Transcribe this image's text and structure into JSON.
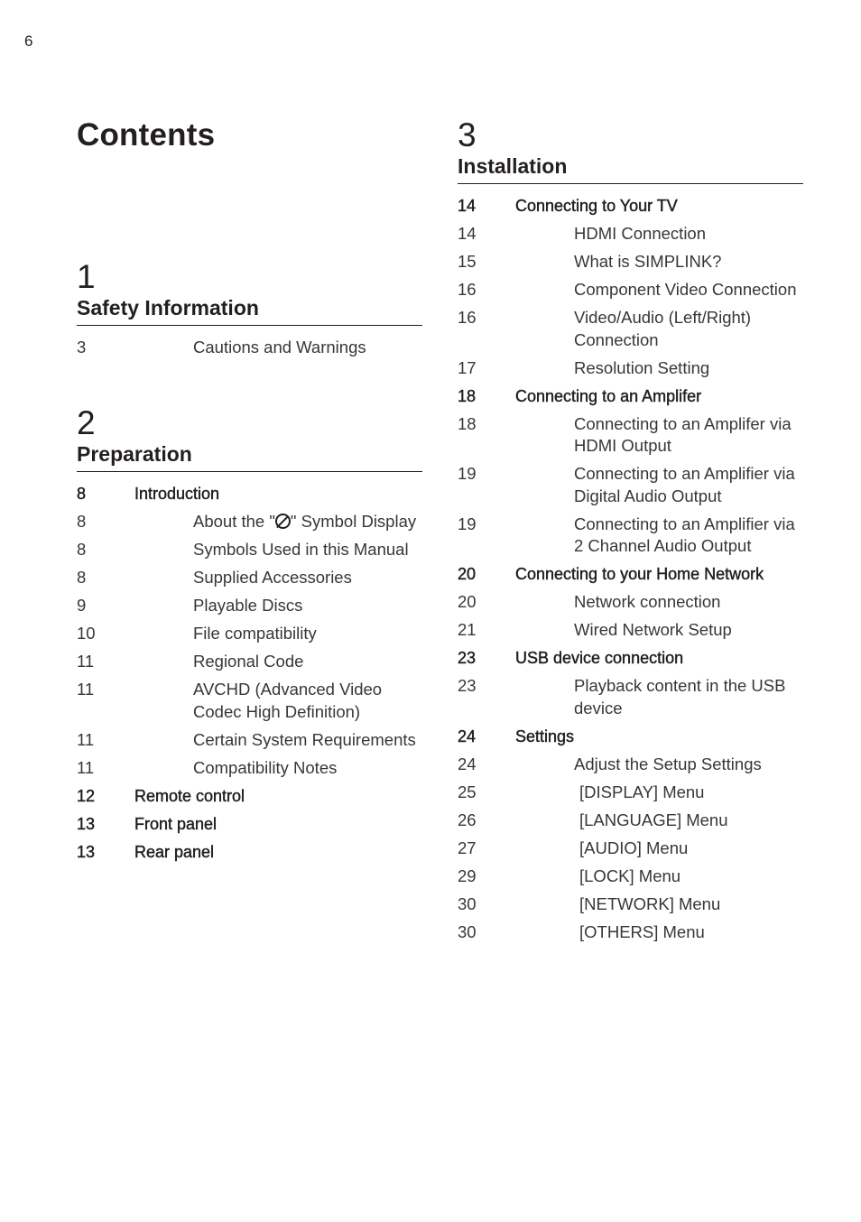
{
  "page_number": "6",
  "title": "Contents",
  "chapters": [
    {
      "number": "1",
      "title": "Safety Information",
      "entries": [
        {
          "page": "3",
          "level": 2,
          "text": "Cautions and Warnings"
        }
      ]
    },
    {
      "number": "2",
      "title": "Preparation",
      "entries": [
        {
          "page": "8",
          "level": 1,
          "text": "Introduction"
        },
        {
          "page": "8",
          "level": 2,
          "text_before": "About the \"",
          "icon": "prohibited-symbol-icon",
          "text_after": "\" Symbol Display"
        },
        {
          "page": "8",
          "level": 2,
          "text": "Symbols Used in this Manual"
        },
        {
          "page": "8",
          "level": 2,
          "text": "Supplied Accessories"
        },
        {
          "page": "9",
          "level": 2,
          "text": "Playable Discs"
        },
        {
          "page": "10",
          "level": 2,
          "text": "File compatibility"
        },
        {
          "page": "11",
          "level": 2,
          "text": "Regional Code"
        },
        {
          "page": "11",
          "level": 2,
          "text": "AVCHD (Advanced Video Codec High Definition)"
        },
        {
          "page": "11",
          "level": 2,
          "text": "Certain System Requirements"
        },
        {
          "page": "11",
          "level": 2,
          "text": "Compatibility Notes"
        },
        {
          "page": "12",
          "level": 1,
          "text": "Remote control"
        },
        {
          "page": "13",
          "level": 1,
          "text": "Front panel"
        },
        {
          "page": "13",
          "level": 1,
          "text": "Rear panel"
        }
      ]
    },
    {
      "number": "3",
      "title": "Installation",
      "entries": [
        {
          "page": "14",
          "level": 1,
          "text": "Connecting to Your TV"
        },
        {
          "page": "14",
          "level": 2,
          "text": "HDMI Connection"
        },
        {
          "page": "15",
          "level": 2,
          "text": "What is SIMPLINK?"
        },
        {
          "page": "16",
          "level": 2,
          "text": "Component Video Connection"
        },
        {
          "page": "16",
          "level": 2,
          "text": "Video/Audio (Left/Right) Connection"
        },
        {
          "page": "17",
          "level": 2,
          "text": "Resolution Setting"
        },
        {
          "page": "18",
          "level": 1,
          "text": "Connecting to an Amplifer"
        },
        {
          "page": "18",
          "level": 2,
          "text": "Connecting to an Amplifer via HDMI Output"
        },
        {
          "page": "19",
          "level": 2,
          "text": "Connecting to an Amplifier via Digital Audio Output"
        },
        {
          "page": "19",
          "level": 2,
          "text": "Connecting to an Amplifier via 2 Channel Audio Output"
        },
        {
          "page": "20",
          "level": 1,
          "text": "Connecting to your Home Network"
        },
        {
          "page": "20",
          "level": 2,
          "text": "Network connection"
        },
        {
          "page": "21",
          "level": 2,
          "text": "Wired Network Setup"
        },
        {
          "page": "23",
          "level": 1,
          "text": "USB device connection"
        },
        {
          "page": "23",
          "level": 2,
          "text": "Playback content in the USB device"
        },
        {
          "page": "24",
          "level": 1,
          "text": "Settings"
        },
        {
          "page": "24",
          "level": 2,
          "text": "Adjust the Setup Settings"
        },
        {
          "page": "25",
          "level": 3,
          "text": "[DISPLAY] Menu"
        },
        {
          "page": "26",
          "level": 3,
          "text": "[LANGUAGE] Menu"
        },
        {
          "page": "27",
          "level": 3,
          "text": "[AUDIO] Menu"
        },
        {
          "page": "29",
          "level": 3,
          "text": "[LOCK] Menu"
        },
        {
          "page": "30",
          "level": 3,
          "text": "[NETWORK] Menu"
        },
        {
          "page": "30",
          "level": 3,
          "text": "[OTHERS] Menu"
        }
      ]
    }
  ]
}
